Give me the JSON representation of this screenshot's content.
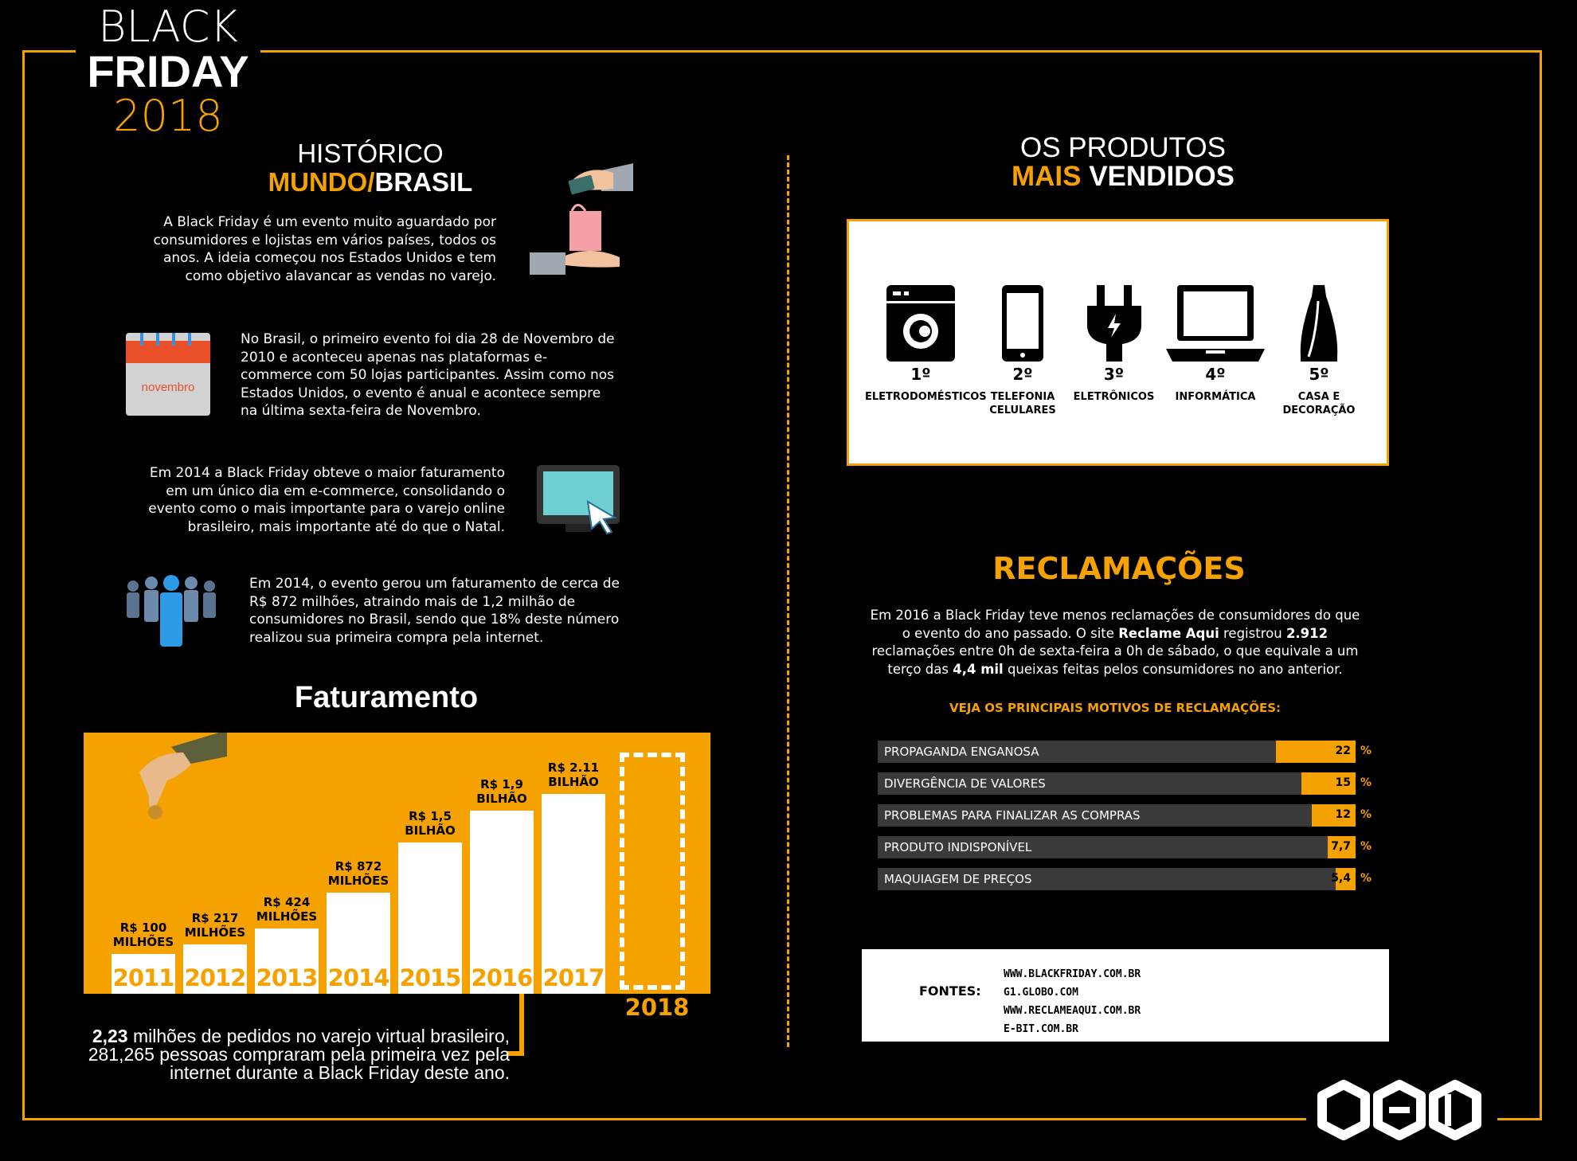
{
  "header": {
    "title_line1": "BLACK",
    "title_line2": "FRIDAY",
    "title_line3": "2018"
  },
  "historico": {
    "heading_line1": "HISTÓRICO",
    "heading_orange": "MUNDO/",
    "heading_white": "BRASIL",
    "p1": "A Black Friday é um evento muito aguardado por consumidores e lojistas em vários países, todos os anos. A ideia começou nos Estados Unidos e tem como objetivo alavancar as vendas no varejo.",
    "calendar_label": "novembro",
    "p2": "No Brasil, o primeiro evento foi dia 28 de Novembro de 2010 e aconteceu apenas nas plataformas e-commerce com 50 lojas participantes. Assim como nos Estados Unidos, o evento é anual e acontece sempre na última sexta-feira de Novembro.",
    "p3": "Em 2014 a Black Friday obteve o maior faturamento em um único dia em e-commerce, consolidando o evento como o mais importante para o varejo online brasileiro, mais importante até do que o Natal.",
    "p4": "Em 2014, o evento gerou um faturamento de cerca de R$ 872 milhões, atraindo mais de 1,2 milhão de consumidores no Brasil, sendo que 18% deste número realizou sua primeira compra pela internet."
  },
  "faturamento": {
    "title": "Faturamento",
    "year_2018": "2018",
    "callout_bold": "2,23",
    "callout_rest": " milhões de pedidos no varejo virtual brasileiro, 281,265 pessoas compraram pela primeira vez pela internet durante a Black Friday deste ano."
  },
  "chart_data": {
    "type": "bar",
    "title": "Faturamento",
    "categories": [
      "2011",
      "2012",
      "2013",
      "2014",
      "2015",
      "2016",
      "2017",
      "2018"
    ],
    "values_brl_millions": [
      100,
      217,
      424,
      872,
      1500,
      1900,
      2110,
      null
    ],
    "value_labels": [
      [
        "R$ 100",
        "MILHÕES"
      ],
      [
        "R$ 217",
        "MILHÕES"
      ],
      [
        "R$ 424",
        "MILHÕES"
      ],
      [
        "R$ 872",
        "MILHÕES"
      ],
      [
        "R$ 1,5",
        "BILHÃO"
      ],
      [
        "R$ 1,9",
        "BILHÃO"
      ],
      [
        "R$ 2.11",
        "BILHÃO"
      ],
      [
        "",
        ""
      ]
    ],
    "colors": {
      "background": "#f5a100",
      "bar": "#ffffff",
      "year_text": "#f5a100"
    }
  },
  "produtos": {
    "heading_line1": "OS PRODUTOS",
    "heading_orange": "MAIS",
    "heading_white": "VENDIDOS",
    "items": [
      {
        "rank": "1º",
        "label1": "ELETRODOMÉSTICOS",
        "label2": "",
        "icon": "washing-machine-icon"
      },
      {
        "rank": "2º",
        "label1": "TELEFONIA",
        "label2": "CELULARES",
        "icon": "smartphone-icon"
      },
      {
        "rank": "3º",
        "label1": "ELETRÔNICOS",
        "label2": "",
        "icon": "plug-icon"
      },
      {
        "rank": "4º",
        "label1": "INFORMÁTICA",
        "label2": "",
        "icon": "laptop-icon"
      },
      {
        "rank": "5º",
        "label1": "CASA E",
        "label2": "DECORAÇÃO",
        "icon": "vase-icon"
      }
    ]
  },
  "reclamacoes": {
    "title": "RECLAMAÇÕES",
    "body_a": "Em 2016 a Black Friday teve menos reclamações de consumidores do que o evento do ano passado. O site ",
    "body_b": "Reclame Aqui",
    "body_c": " registrou ",
    "body_d": "2.912",
    "body_e": " reclamações entre 0h de sexta-feira a 0h de sábado, o que equivale a um terço das ",
    "body_f": "4,4 mil",
    "body_g": " queixas feitas pelos consumidores no ano anterior.",
    "motivos_heading": "VEJA OS PRINCIPAIS MOTIVOS DE RECLAMAÇÕES:",
    "motivos": [
      {
        "label": "PROPAGANDA ENGANOSA",
        "value_text": "22",
        "value": 22
      },
      {
        "label": "DIVERGÊNCIA DE VALORES",
        "value_text": "15",
        "value": 15
      },
      {
        "label": "PROBLEMAS PARA FINALIZAR AS COMPRAS",
        "value_text": "12",
        "value": 12
      },
      {
        "label": "PRODUTO INDISPONÍVEL",
        "value_text": "7,7",
        "value": 7.7
      },
      {
        "label": "MAQUIAGEM DE PREÇOS",
        "value_text": "5,4",
        "value": 5.4
      }
    ],
    "pct_symbol": "%"
  },
  "fontes": {
    "label": "FONTES:",
    "links": [
      "WWW.BLACKFRIDAY.COM.BR",
      "G1.GLOBO.COM",
      "WWW.RECLAMEAQUI.COM.BR",
      "E-BIT.COM.BR"
    ]
  },
  "colors": {
    "accent": "#f5a100",
    "background": "#000000",
    "bar_dark": "#3a3a3a"
  }
}
